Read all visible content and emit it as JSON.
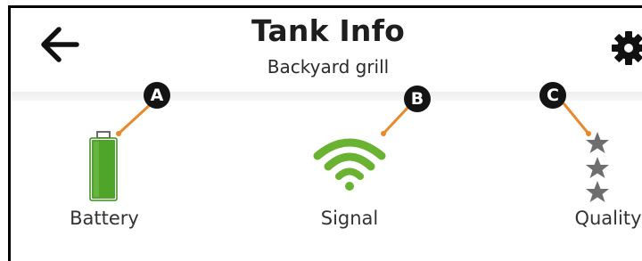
{
  "header": {
    "title": "Tank Info",
    "subtitle": "Backyard grill",
    "back_icon": "arrow-left-icon",
    "settings_icon": "gear-icon"
  },
  "stats": [
    {
      "label": "Battery",
      "icon": "battery-icon",
      "level": 1.0,
      "color": "#4ea52a"
    },
    {
      "label": "Signal",
      "icon": "wifi-signal-icon",
      "bars": 3,
      "color": "#6ab232"
    },
    {
      "label": "Quality",
      "icon": "star-rating-icon",
      "stars": 3,
      "color": "#6e6e6e"
    }
  ],
  "callouts": [
    {
      "letter": "A",
      "target": "battery-icon"
    },
    {
      "letter": "B",
      "target": "wifi-signal-icon"
    },
    {
      "letter": "C",
      "target": "star-rating-icon"
    }
  ],
  "colors": {
    "callout_line": "#e8892b",
    "callout_badge": "#141414",
    "battery": "#4ea52a",
    "signal": "#6ab232",
    "stars": "#6e6e6e"
  }
}
